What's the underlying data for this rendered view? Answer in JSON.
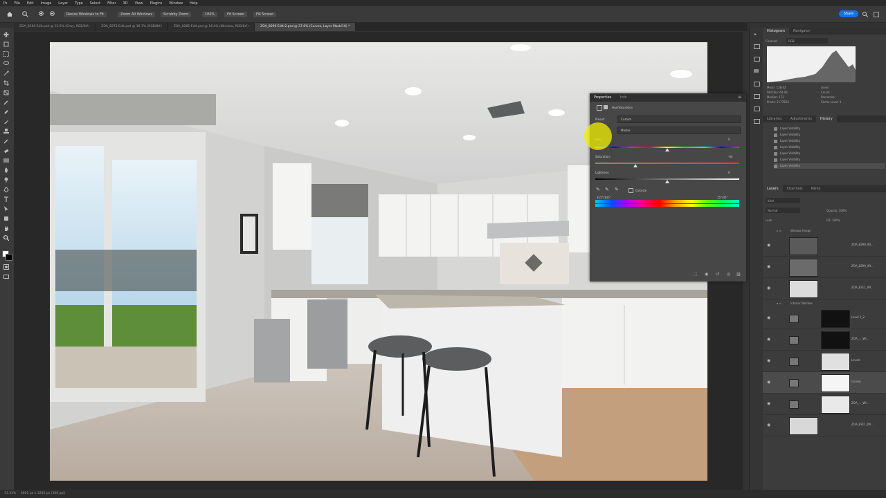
{
  "menu": [
    "Ps",
    "File",
    "Edit",
    "Image",
    "Layer",
    "Type",
    "Select",
    "Filter",
    "3D",
    "View",
    "Plugins",
    "Window",
    "Help"
  ],
  "options": {
    "resize_windows": "Resize Windows to Fit",
    "zoom_all": "Zoom All Windows",
    "scrubby_zoom": "Scrubby Zoom",
    "zoom_pct": "100%",
    "fit_screen": "Fit Screen",
    "fill_screen": "Fill Screen",
    "share": "Share"
  },
  "tabs": [
    "ZOA_8269-Edit.psd @ 12.5% (Gray, RGB/8#)",
    "ZOA_8275-Edit.psd @ 16.7% (RGB/8#)",
    "ZOA_8285-Edit.psd @ 16.4% (Window, RGB/8#)",
    "ZOA_8096-Edit-2.psd @ 37.6% (Curves, Layer Mask/16) *"
  ],
  "status": {
    "zoom": "33.33%",
    "doc_info": "4802 px x 3202 px (300 ppi)"
  },
  "panels": {
    "histogram_tabs": [
      "Histogram",
      "Navigator"
    ],
    "channel_label": "Channel:",
    "channel_value": "RGB",
    "hist_stats": [
      "Mean: 128.42",
      "Std Dev: 64.09",
      "Median: 172",
      "Pixels: 1177824"
    ],
    "hist_stats_right": [
      "Level:",
      "Count:",
      "Percentile:",
      "Cache Level: 1"
    ],
    "history_tabs": [
      "Libraries",
      "Adjustments",
      "History"
    ],
    "history_items": [
      "Layer Visibility",
      "Layer Visibility",
      "Layer Visibility",
      "Layer Visibility",
      "Layer Visibility",
      "Layer Visibility",
      "Layer Visibility"
    ],
    "layers_tabs": [
      "Layers",
      "Channels",
      "Paths"
    ],
    "layers_kind": "Kind",
    "blend_mode": "Normal",
    "opacity": "Opacity: 100%",
    "lock": "Lock:",
    "fill": "Fill: 100%",
    "group1": "Window Image",
    "group2": "Interior Window",
    "layers": [
      {
        "name": "ZOA_8299_WI..."
      },
      {
        "name": "ZOA_8299_WI..."
      },
      {
        "name": "ZOA_8311_WI..."
      },
      {
        "name": "Level 1_2"
      },
      {
        "name": "ZOA_..._WI..."
      },
      {
        "name": "Levels"
      },
      {
        "name": "Curves"
      },
      {
        "name": "ZOA_..._WI..."
      },
      {
        "name": "ZOA_8311_WI..."
      }
    ]
  },
  "properties": {
    "tabs": [
      "Properties",
      "Info"
    ],
    "type": "Hue/Saturation",
    "preset_label": "Preset:",
    "preset_value": "Custom",
    "channel": "Master",
    "hue_label": "Hue:",
    "hue_value": "0",
    "sat_label": "Saturation:",
    "sat_value": "-44",
    "light_label": "Lightness:",
    "light_value": "0",
    "colorize": "Colorize",
    "range_left": "315°/345°",
    "range_right": "15°/45°",
    "hue_pos": 0.5,
    "sat_pos": 0.28,
    "light_pos": 0.5
  }
}
